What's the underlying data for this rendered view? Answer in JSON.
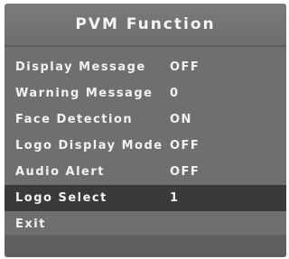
{
  "header": {
    "title": "PVM Function"
  },
  "menu": {
    "items": [
      {
        "label": "Display Message",
        "value": "OFF"
      },
      {
        "label": "Warning Message",
        "value": "0"
      },
      {
        "label": "Face Detection",
        "value": "ON"
      },
      {
        "label": "Logo Display Mode",
        "value": "OFF"
      },
      {
        "label": "Audio Alert",
        "value": "OFF"
      },
      {
        "label": "Logo Select",
        "value": "1",
        "selected": true
      },
      {
        "label": "Exit",
        "value": ""
      }
    ]
  },
  "colors": {
    "panel": "#6f6f6f",
    "selected_row": "#3a3a3a",
    "text": "#f2f2f2"
  }
}
